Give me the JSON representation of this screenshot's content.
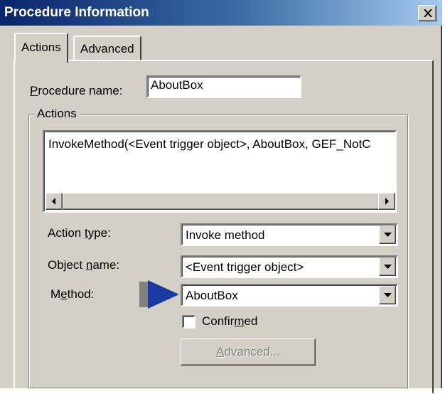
{
  "window": {
    "title": "Procedure Information",
    "close_symbol": "×"
  },
  "tabs": [
    {
      "label": "Actions",
      "active": true
    },
    {
      "label": "Advanced",
      "active": false
    }
  ],
  "procedure_name": {
    "label_accel": "P",
    "label_rest": "rocedure name:",
    "value": "AboutBox"
  },
  "actions_group": {
    "legend": "Actions",
    "list_items": [
      "InvokeMethod(<Event trigger object>, AboutBox, GEF_NotC"
    ]
  },
  "action_type": {
    "label_pre": "Action ",
    "label_accel": "t",
    "label_post": "ype:",
    "value": "Invoke method"
  },
  "object_name": {
    "label_pre": "Object ",
    "label_accel": "n",
    "label_post": "ame:",
    "value": "<Event trigger object>"
  },
  "method": {
    "label_pre": "M",
    "label_accel": "e",
    "label_post": "thod:",
    "value": "AboutBox"
  },
  "confirmed": {
    "label_pre": "Confir",
    "label_accel": "m",
    "label_post": "ed",
    "checked": false
  },
  "advanced_button": {
    "label_accel": "A",
    "label_rest": "dvanced..."
  },
  "colors": {
    "title_gradient_start": "#0a246a",
    "title_gradient_end": "#a6caf0",
    "face": "#d4d0c8",
    "pointer_arrow": "#1a3aa0"
  },
  "icons": [
    "close-icon",
    "scroll-left-icon",
    "scroll-right-icon",
    "dropdown-arrow-icon",
    "pointer-arrow-icon"
  ]
}
